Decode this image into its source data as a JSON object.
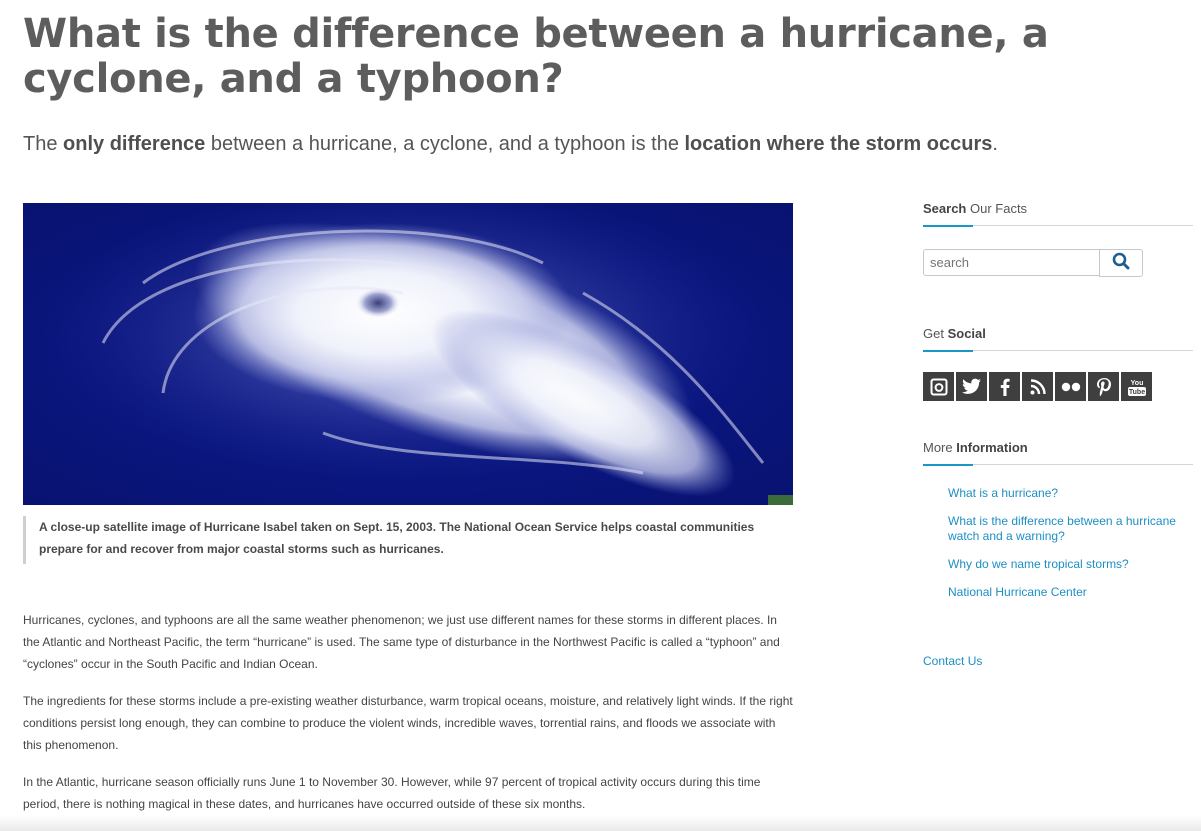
{
  "page": {
    "title": "What is the difference between a hurricane, a cyclone, and a typhoon?",
    "subtitle_parts": {
      "a": "The ",
      "b": "only difference",
      "c": " between a hurricane, a cyclone, and a typhoon is the ",
      "d": "location where the storm occurs",
      "e": "."
    }
  },
  "image": {
    "caption": "A close-up satellite image of Hurricane Isabel taken on Sept. 15, 2003. The National Ocean Service helps coastal communities prepare for and recover from major coastal storms such as hurricanes."
  },
  "article": {
    "paragraphs": [
      "Hurricanes, cyclones, and typhoons are all the same weather phenomenon; we just use different names for these storms in different places. In the Atlantic and Northeast Pacific, the term “hurricane” is used. The same type of disturbance in the Northwest Pacific is called a “typhoon” and “cyclones” occur in the South Pacific and Indian Ocean.",
      "The ingredients for these storms include a pre-existing weather disturbance, warm tropical oceans, moisture, and relatively light winds. If the right conditions persist long enough, they can combine to produce the violent winds, incredible waves, torrential rains, and floods we associate with this phenomenon.",
      "In the Atlantic, hurricane season officially runs June 1 to November 30. However, while 97 percent of tropical activity occurs during this time period, there is nothing magical in these dates, and hurricanes have occurred outside of these six months."
    ]
  },
  "sidebar": {
    "search_heading": {
      "bold": "Search",
      "rest": " Our Facts"
    },
    "search_placeholder": "search",
    "social_heading": {
      "pre": "Get ",
      "bold": "Social"
    },
    "social_icons": [
      "instagram-icon",
      "twitter-icon",
      "facebook-icon",
      "rss-icon",
      "flickr-icon",
      "pinterest-icon",
      "youtube-icon"
    ],
    "youtube_label": "You Tube",
    "more_heading": {
      "pre": "More ",
      "bold": "Information"
    },
    "links": [
      "What is a hurricane?",
      "What is the difference between a hurricane watch and a warning?",
      "Why do we name tropical storms?",
      "National Hurricane Center"
    ],
    "contact": "Contact Us"
  },
  "colors": {
    "link": "#1c8fc4",
    "accent_underline": "#1a97c9",
    "social_bg": "#3f3f3f",
    "ocean": "#0a167e"
  }
}
